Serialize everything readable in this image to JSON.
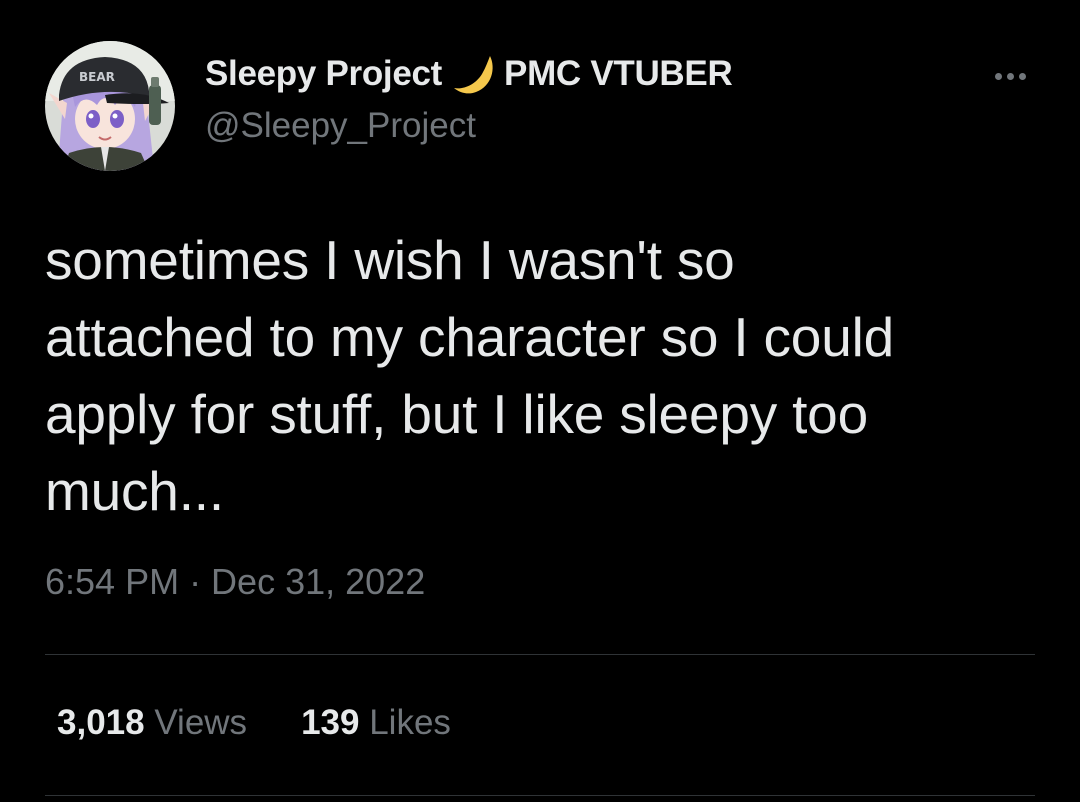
{
  "author": {
    "display_name": "Sleepy Project",
    "name_suffix": "PMC VTUBER",
    "handle": "@Sleepy_Project",
    "avatar_icon": "vtuber-avatar",
    "avatar_cap_text": "BEAR"
  },
  "tweet": {
    "text_lines": [
      "sometimes I wish I wasn't so",
      "attached to my character so I could",
      "apply for stuff, but I like sleepy too",
      "much..."
    ],
    "timestamp": "6:54 PM · Dec 31, 2022"
  },
  "stats": {
    "views_count": "3,018",
    "views_label": "Views",
    "likes_count": "139",
    "likes_label": "Likes"
  },
  "icons": {
    "moon": "crescent-moon-icon",
    "more": "more-options-icon"
  },
  "colors": {
    "background": "#000000",
    "primary_text": "#e7e9ea",
    "secondary_text": "#71767b",
    "divider": "#2f3336",
    "moon": "#f5c84c"
  }
}
